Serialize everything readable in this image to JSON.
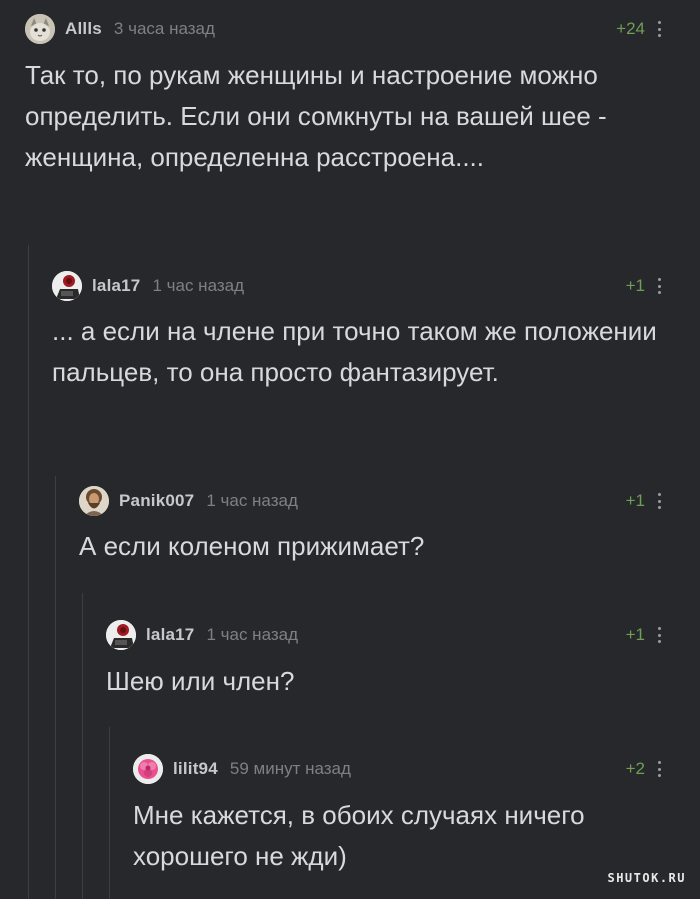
{
  "comments": [
    {
      "nick": "Allls",
      "time": "3 часа назад",
      "rating": "+24",
      "avatar": "cat-avatar",
      "text": "Так то, по рукам женщины и настроение можно определить. Если они сомкнуты на вашей шее - женщина, определенна расстроена...."
    },
    {
      "nick": "lala17",
      "time": "1 час назад",
      "rating": "+1",
      "avatar": "skull-rose-avatar",
      "text": "... а если на члене при точно таком же положении пальцев, то она просто фантазирует."
    },
    {
      "nick": "Panik007",
      "time": "1 час назад",
      "rating": "+1",
      "avatar": "bearded-man-avatar",
      "text": "А если коленом прижимает?"
    },
    {
      "nick": "lala17",
      "time": "1 час назад",
      "rating": "+1",
      "avatar": "skull-rose-avatar",
      "text": "Шею или член?"
    },
    {
      "nick": "lilit94",
      "time": "59 минут назад",
      "rating": "+2",
      "avatar": "pink-flower-avatar",
      "text": "Мне кажется, в обоих случаях ничего хорошего не жди)"
    }
  ],
  "watermark": "SHUTOK.RU",
  "colors": {
    "background": "#27282b",
    "rating": "#6f9f56",
    "thread_line": "#3c3e42"
  }
}
